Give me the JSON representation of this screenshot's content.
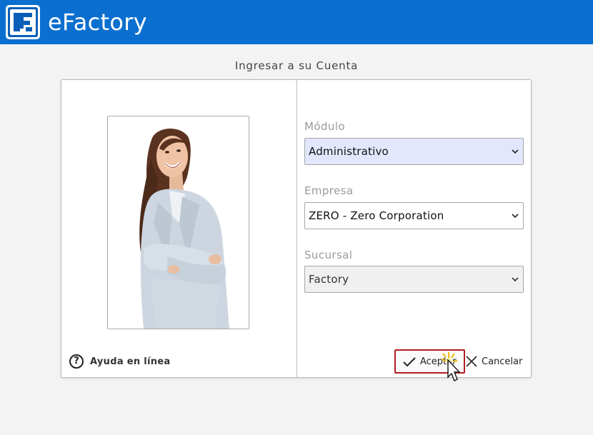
{
  "app": {
    "title": "eFactory"
  },
  "login": {
    "title": "Ingresar a su Cuenta",
    "help_label": "Ayuda en línea",
    "fields": {
      "modulo": {
        "label": "Módulo",
        "value": "Administrativo",
        "background": "#e3e7fd"
      },
      "empresa": {
        "label": "Empresa",
        "value": "ZERO - Zero Corporation",
        "background": "#ffffff"
      },
      "sucursal": {
        "label": "Sucursal",
        "value": "Factory",
        "background": "#f0f0f0"
      }
    },
    "buttons": {
      "accept": "Aceptar",
      "cancel": "Cancelar"
    }
  },
  "colors": {
    "topbar": "#0a6fcf",
    "accept_border": "#b21e24"
  }
}
